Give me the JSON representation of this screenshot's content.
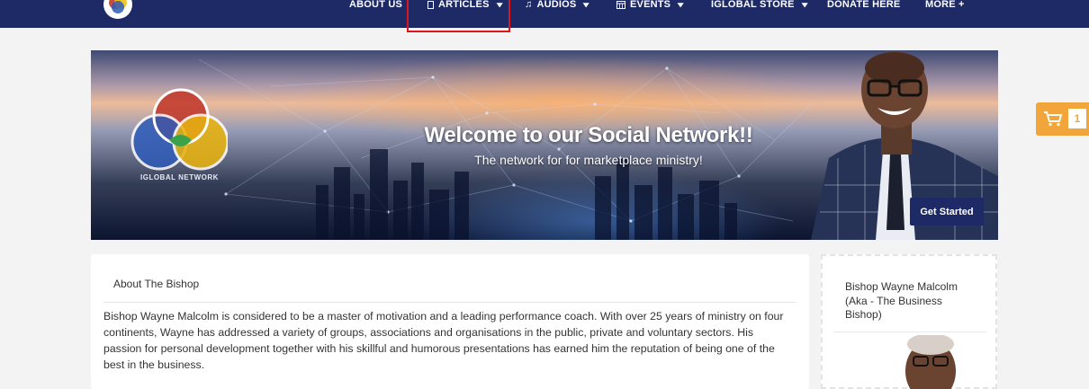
{
  "nav": {
    "items": [
      {
        "label": "ABOUT US",
        "has_dropdown": false,
        "icon": null
      },
      {
        "label": "ARTICLES",
        "has_dropdown": true,
        "icon": "document-icon"
      },
      {
        "label": "AUDIOS",
        "has_dropdown": true,
        "icon": "music-note-icon"
      },
      {
        "label": "EVENTS",
        "has_dropdown": true,
        "icon": "calendar-icon"
      },
      {
        "label": "IGLOBAL STORE",
        "has_dropdown": true,
        "icon": null
      },
      {
        "label": "DONATE HERE",
        "has_dropdown": false,
        "icon": null
      },
      {
        "label": "MORE +",
        "has_dropdown": false,
        "icon": null
      }
    ],
    "highlighted": "ARTICLES"
  },
  "hero": {
    "title": "Welcome to our Social Network!!",
    "subtitle": "The network for for marketplace ministry!",
    "logo_text": "IGLOBAL NETWORK",
    "cta_label": "Get Started"
  },
  "cart": {
    "count": "1",
    "icon": "shopping-cart-icon"
  },
  "about": {
    "title": "About The Bishop",
    "body": "Bishop Wayne Malcolm is considered to be a master of motivation and a leading performance coach. With over 25 years of ministry on four continents, Wayne has addressed a variety of groups, associations and organisations in the public, private and voluntary sectors. His passion for personal development together with his skillful and humorous presentations has earned him the reputation of being one of the best in the business."
  },
  "profile": {
    "name": "Bishop Wayne Malcolm (Aka - The Business Bishop)"
  },
  "colors": {
    "nav_bg": "#1e2a66",
    "accent_orange": "#f2a53a",
    "highlight_red": "#e0141b",
    "page_bg": "#f3f3f3"
  }
}
